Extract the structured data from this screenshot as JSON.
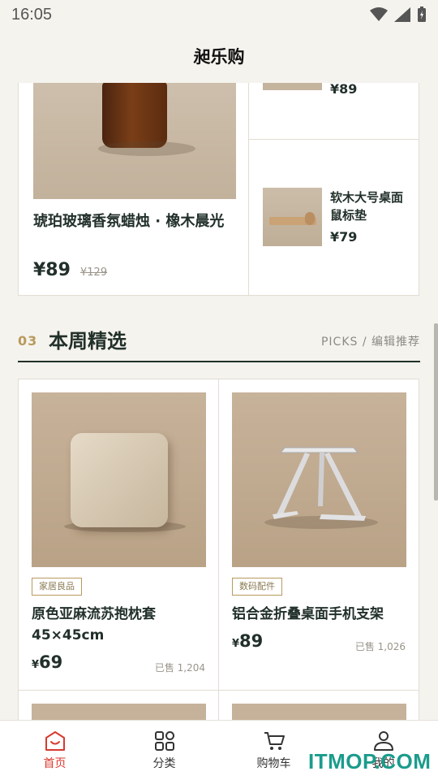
{
  "status": {
    "time": "16:05"
  },
  "app": {
    "title": "昶乐购"
  },
  "prev_section": {
    "big": {
      "name": "琥珀玻璃香氛蜡烛 · 橡木晨光",
      "price": "¥89",
      "original": "¥129"
    },
    "small_top": {
      "price": "¥89"
    },
    "small": {
      "name": "软木大号桌面鼠标垫",
      "price": "¥79"
    }
  },
  "section": {
    "num": "03",
    "title": "本周精选",
    "sub": "PICKS / 编辑推荐"
  },
  "products": [
    {
      "tag": "家居良品",
      "name": "原色亚麻流苏抱枕套 45×45cm",
      "price_symbol": "¥",
      "price": "69",
      "sold": "已售 1,204"
    },
    {
      "tag": "数码配件",
      "name": "铝合金折叠桌面手机支架",
      "price_symbol": "¥",
      "price": "89",
      "sold": "已售 1,026"
    }
  ],
  "nav": [
    {
      "label": "首页",
      "icon": "home-icon",
      "active": true
    },
    {
      "label": "分类",
      "icon": "grid-icon",
      "active": false
    },
    {
      "label": "购物车",
      "icon": "cart-icon",
      "active": false
    },
    {
      "label": "我的",
      "icon": "user-icon",
      "active": false
    }
  ],
  "colors": {
    "accent": "#d83a2e",
    "gold": "#b89a5e",
    "ink": "#22302a",
    "background": "#f5f3ee"
  },
  "watermark": "ITMOP.COM"
}
